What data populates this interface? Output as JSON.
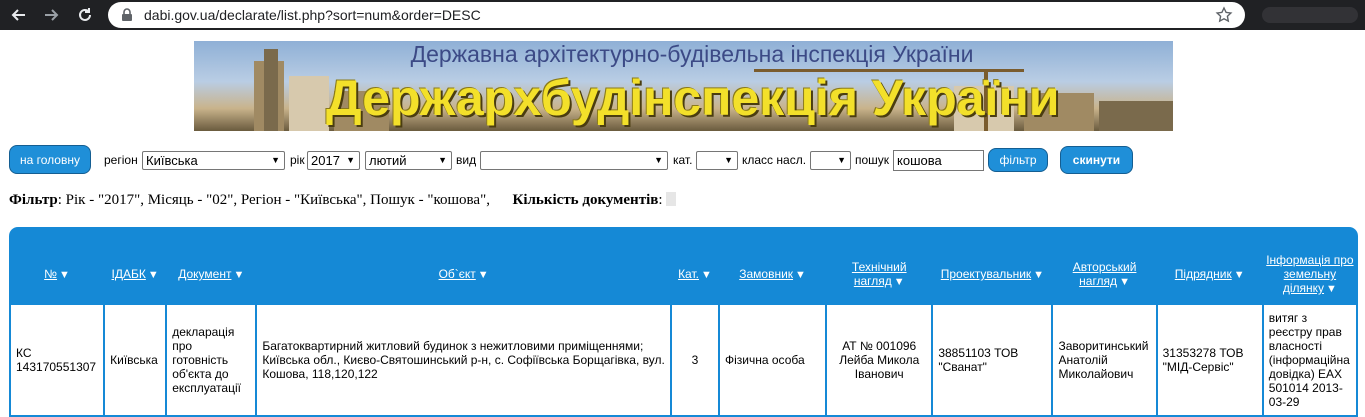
{
  "browser": {
    "url": "dabi.gov.ua/declarate/list.php?sort=num&order=DESC"
  },
  "banner": {
    "subtitle": "Державна архітектурно-будівельна інспекція України",
    "title": "Держархбудінспекція України"
  },
  "filters": {
    "home_label": "на головну",
    "region_label": "регіон",
    "region_value": "Київська",
    "year_label": "рік",
    "year_value": "2017",
    "month_value": "лютий",
    "type_label": "вид",
    "type_value": "",
    "category_label": "кат.",
    "category_value": "",
    "class_label": "класс насл.",
    "class_value": "",
    "search_label": "пошук",
    "search_value": "кошова",
    "filter_label": "фільтр",
    "reset_label": "скинути"
  },
  "summary": {
    "filter_label": "Фільтр",
    "filter_text": ": Рік - \"2017\", Місяць - \"02\", Регіон - \"Київська\", Пошук - \"кошова\",",
    "count_label": "Кількість документів",
    "count_sep": ":"
  },
  "table": {
    "columns": [
      "№",
      "ІДАБК",
      "Документ",
      "Об`єкт",
      "Кат.",
      "Замовник",
      "Технічний нагляд",
      "Проектувальник",
      "Авторський нагляд",
      "Підрядник",
      "Інформація про земельну ділянку"
    ],
    "rows": [
      {
        "num": "КС 143170551307",
        "idabk": "Київська",
        "document": "декларація про готовність об'єкта до експлуатації",
        "object": "Багатоквартирний житловий будинок з нежитловими приміщеннями; Київська обл., Києво-Святошинський р-н, с. Софіївська Борщагівка, вул. Кошова, 118,120,122",
        "category": "3",
        "customer": "Фізична особа",
        "tech_supervision": "АТ № 001096 Лейба Микола Іванович",
        "designer": "38851103 ТОВ \"Сванат\"",
        "author_supervision": "Заворитинський Анатолій Миколайович",
        "contractor": "31353278 ТОВ \"МІД-Сервіс\"",
        "land_info": "витяг з реєстру прав власності (інформаційна довідка) ЕАХ 501014 2013-03-29"
      }
    ]
  }
}
